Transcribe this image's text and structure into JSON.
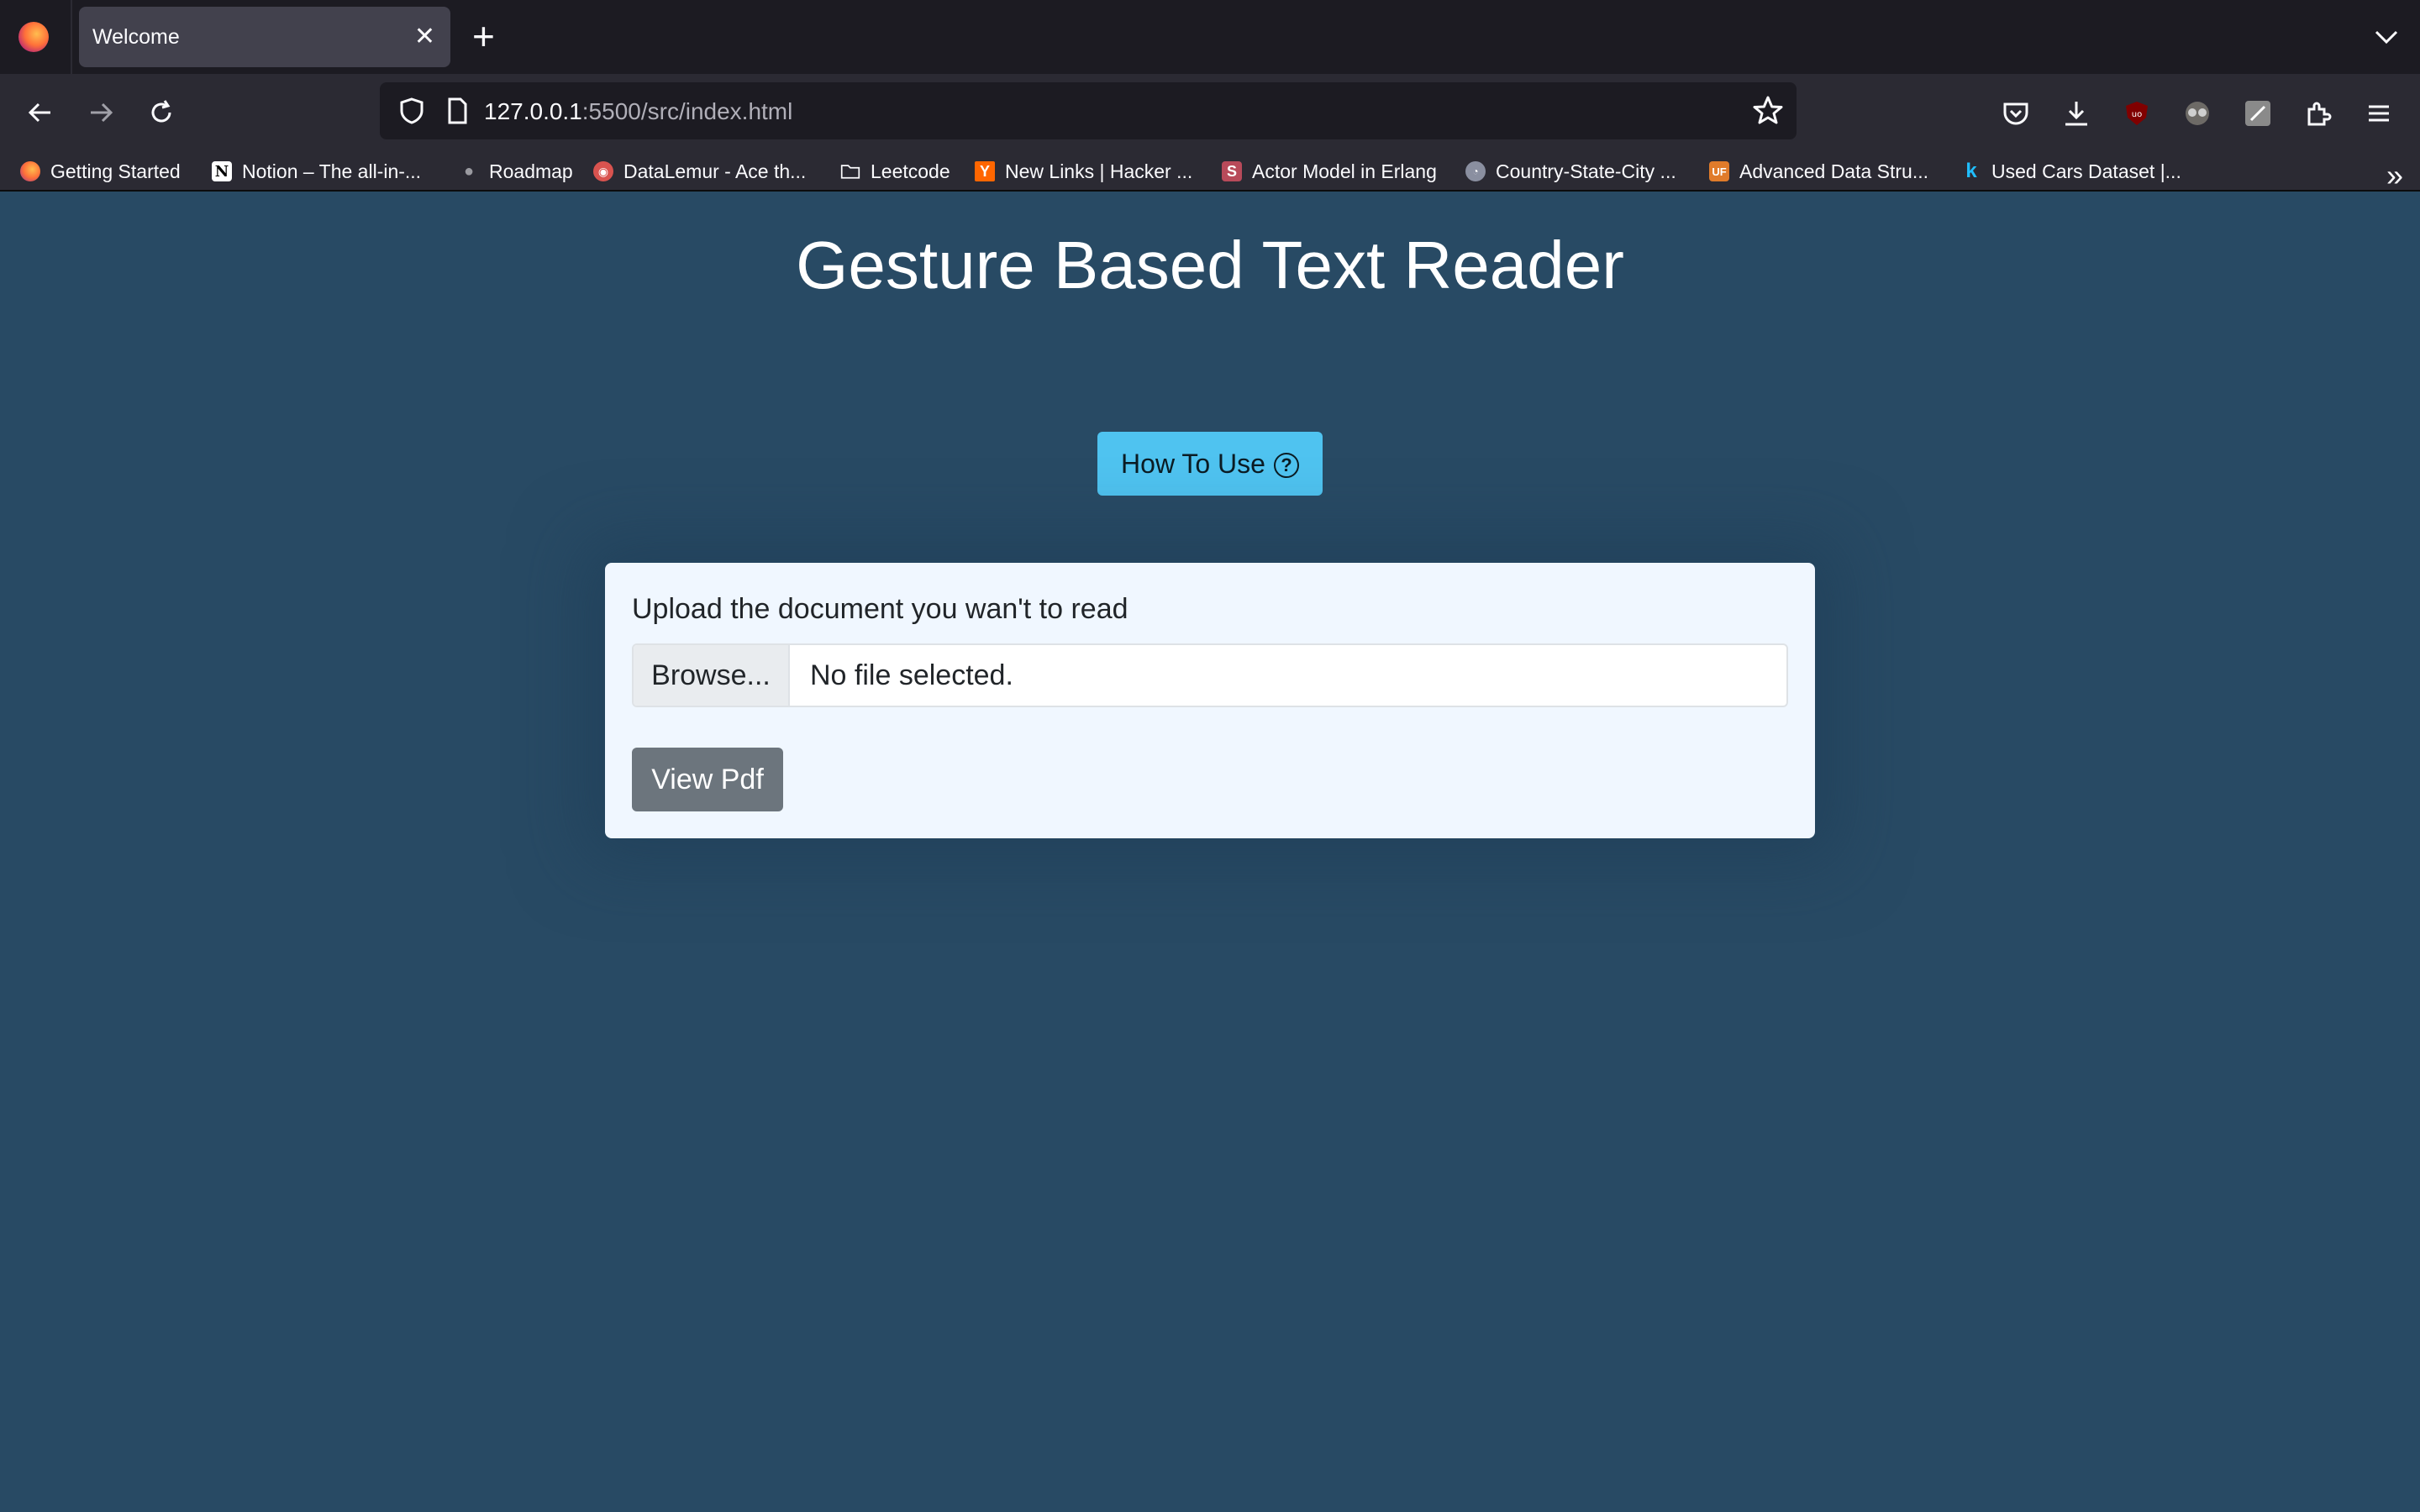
{
  "browser": {
    "tab_title": "Welcome",
    "url_host": "127.0.0.1",
    "url_rest": ":5500/src/index.html",
    "bookmarks": [
      {
        "label": "Getting Started",
        "icon": "firefox-icon",
        "color": "#ff7139"
      },
      {
        "label": "Notion – The all-in-...",
        "icon": "notion-icon",
        "color": "#ffffff"
      },
      {
        "label": "Roadmap",
        "icon": "roadmap-icon",
        "color": "#888888"
      },
      {
        "label": "DataLemur - Ace th...",
        "icon": "datalemur-icon",
        "color": "#d9534f"
      },
      {
        "label": "Leetcode",
        "icon": "folder-icon",
        "color": "#fbfbfe"
      },
      {
        "label": "New Links | Hacker ...",
        "icon": "hackernews-icon",
        "color": "#ff6600",
        "glyph": "Y"
      },
      {
        "label": "Actor Model in Erlang",
        "icon": "actor-model-icon",
        "color": "#b84a5a",
        "glyph": "S"
      },
      {
        "label": "Country-State-City ...",
        "icon": "csc-icon",
        "color": "#8a8fa0"
      },
      {
        "label": "Advanced Data Stru...",
        "icon": "uf-icon",
        "color": "#e07b2a",
        "glyph": "UF"
      },
      {
        "label": "Used Cars Dataset |...",
        "icon": "kaggle-icon",
        "color": "#20beff",
        "glyph": "k"
      }
    ]
  },
  "page": {
    "title": "Gesture Based Text Reader",
    "how_to_label": "How To Use",
    "help_glyph": "?",
    "upload_label": "Upload the document you wan't to read",
    "browse_label": "Browse...",
    "file_status": "No file selected.",
    "view_pdf_label": "View Pdf"
  },
  "colors": {
    "background": "#284a64",
    "accent_button": "#4fc3f0",
    "secondary_button": "#6c757d",
    "card": "#f0f7ff"
  }
}
